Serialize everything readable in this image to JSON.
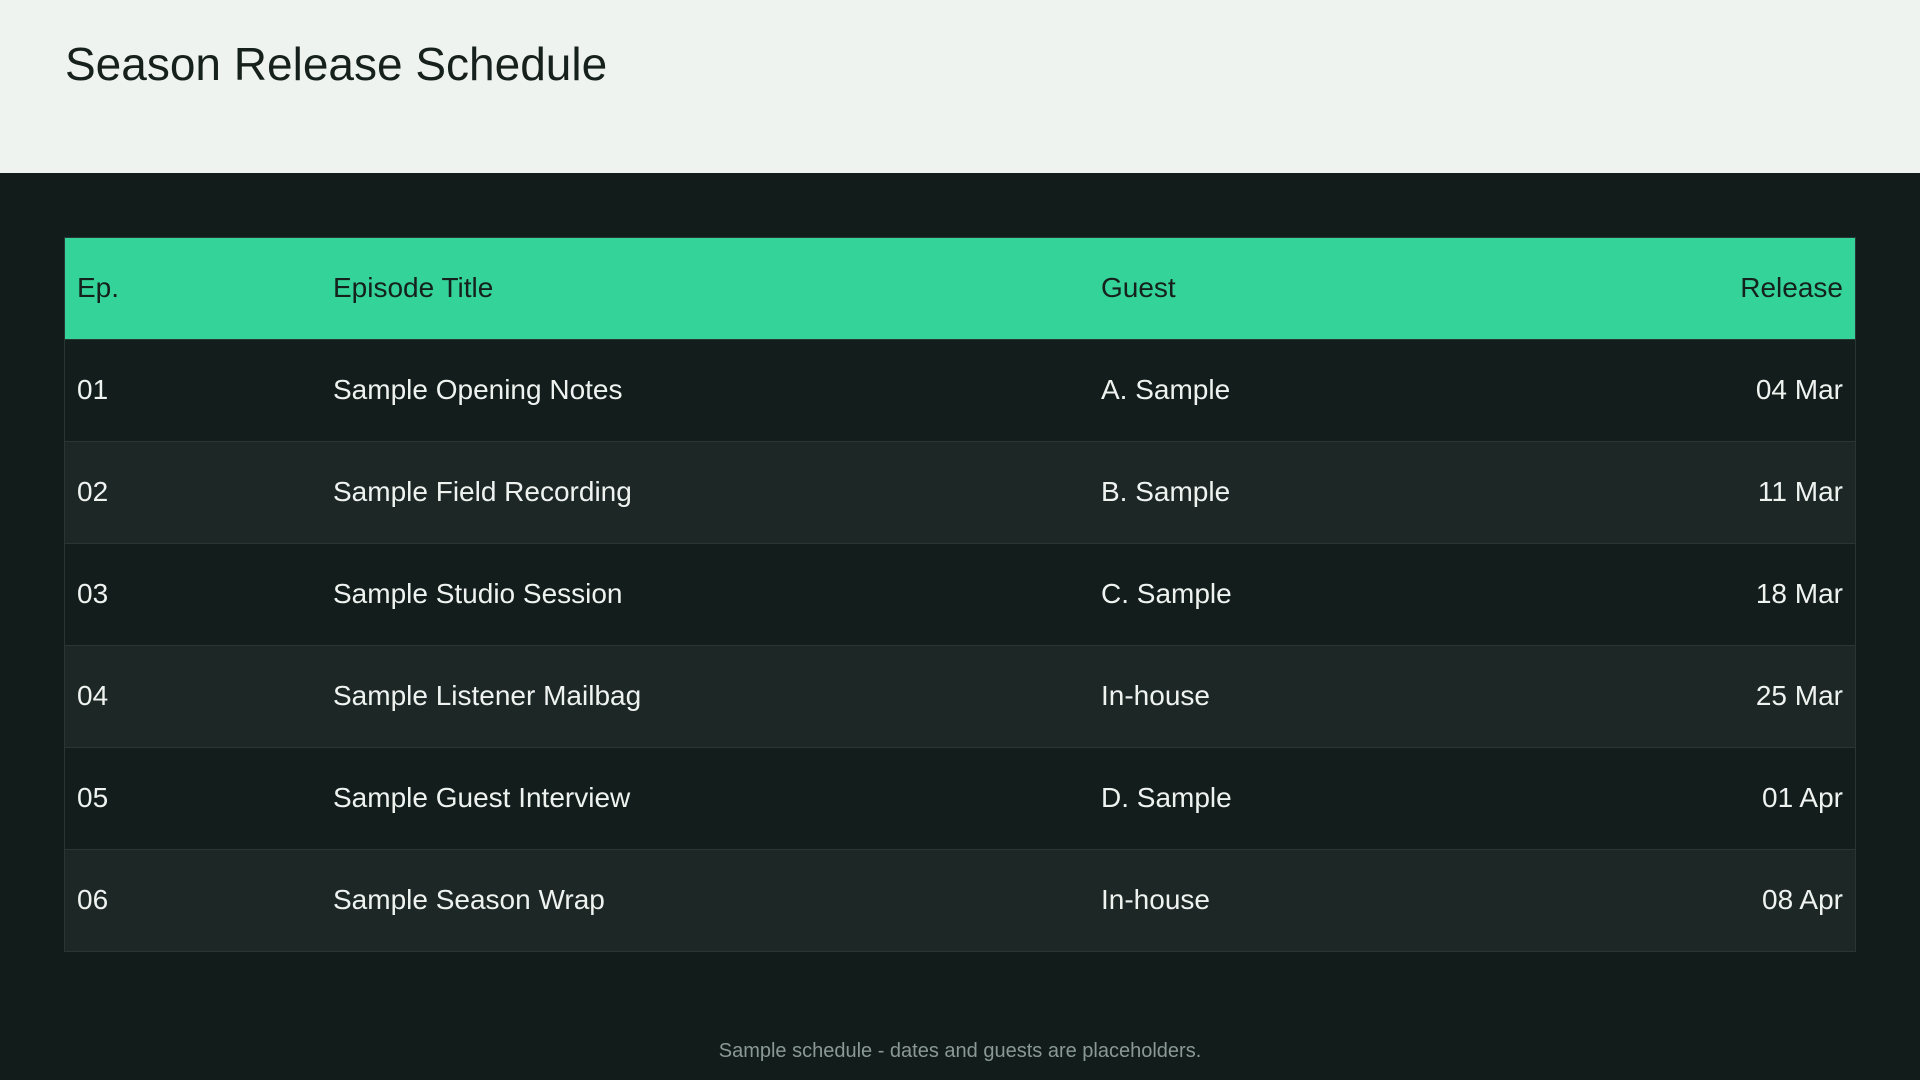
{
  "header": {
    "title": "Season Release Schedule"
  },
  "table": {
    "columns": [
      "Ep.",
      "Episode Title",
      "Guest",
      "Release"
    ],
    "rows": [
      {
        "ep": "01",
        "title": "Sample Opening Notes",
        "guest": "A. Sample",
        "release": "04 Mar"
      },
      {
        "ep": "02",
        "title": "Sample Field Recording",
        "guest": "B. Sample",
        "release": "11 Mar"
      },
      {
        "ep": "03",
        "title": "Sample Studio Session",
        "guest": "C. Sample",
        "release": "18 Mar"
      },
      {
        "ep": "04",
        "title": "Sample Listener Mailbag",
        "guest": "In-house",
        "release": "25 Mar"
      },
      {
        "ep": "05",
        "title": "Sample Guest Interview",
        "guest": "D. Sample",
        "release": "01 Apr"
      },
      {
        "ep": "06",
        "title": "Sample Season Wrap",
        "guest": "In-house",
        "release": "08 Apr"
      }
    ]
  },
  "footer": {
    "note": "Sample schedule - dates and guests are placeholders."
  },
  "colors": {
    "accent": "#34d399",
    "background": "#121c1a",
    "header_background": "#eff3ef"
  }
}
